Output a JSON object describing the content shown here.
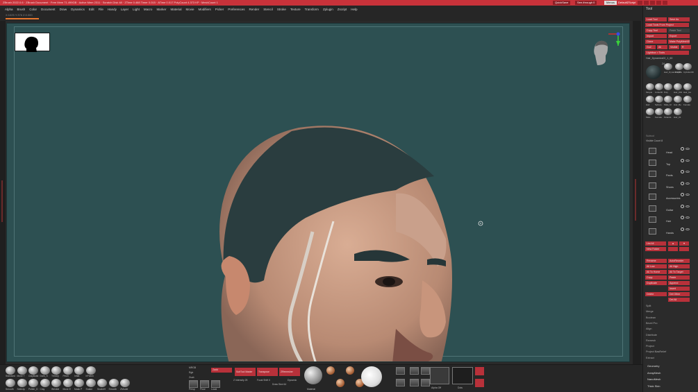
{
  "titlebar": {
    "title": "ZBrush 2022.0.6 · ZBrush Document · Free Mem 71.499GB · Active Mem 2311 · Scratch Disk 48 · ZTime 0.468 Timer 0.015 · ATime 0.017 PolyCount 4.373 KP · MeshCount 1",
    "quicksave": "QuickSave",
    "seethrough": "See-through 0",
    "menus": "Menus",
    "defaultscript": "DefaultZScript"
  },
  "menubar": [
    "Alpha",
    "Brush",
    "Color",
    "Document",
    "Draw",
    "Dynamics",
    "Edit",
    "File",
    "Handy",
    "Layer",
    "Light",
    "Macro",
    "Marker",
    "Material",
    "Movie",
    "Modifiers",
    "Picker",
    "Preferences",
    "Render",
    "Stencil",
    "Stroke",
    "Texture",
    "Transform",
    "Zplugin",
    "Zscript",
    "Help"
  ],
  "infobar": {
    "coords": "X:1025 Y:376 Z:0.000",
    "progress": 0.05
  },
  "tray": {
    "title": "Tool",
    "top_buttons": [
      [
        "Load Tool",
        "Save As"
      ],
      [
        "Load Tools From Project"
      ],
      [
        "Copy Tool",
        "Paste Tool"
      ],
      [
        "Import",
        "Export"
      ],
      [
        "Clone",
        "Make PolyMesh3D"
      ],
      [
        "GoZ",
        "All",
        "Visible",
        "R"
      ],
      [
        "Lightbox > Tools"
      ]
    ],
    "current_tool": "Hair_Dynamics02_1_60",
    "tool_count": "24",
    "tool_labels": [
      "Hair_Dynamics02",
      "PolyMe",
      "Cylinder3D",
      "Simple",
      "Cube3D",
      "Poly",
      "Hair_001",
      "Hair_Go",
      "Hair",
      "Sphere",
      "Male_M",
      "Hair_Be",
      "Female",
      "Male",
      "Female",
      "Strands",
      "Hair_01"
    ],
    "subtool_header": "Subtool",
    "visible_count": "Visible Count 8",
    "subtools": [
      "Head",
      "Top",
      "Pants",
      "Shoes",
      "Accessories",
      "Guitar",
      "Hair",
      "Hands"
    ],
    "list_buttons": [
      [
        "List All",
        "▲",
        "▼"
      ],
      [
        "New Folder",
        "",
        ""
      ]
    ],
    "action_buttons": [
      [
        "Rename",
        "AutoReorder"
      ],
      [
        "All Low",
        "All High"
      ],
      [
        "All To Home",
        "All To Target"
      ],
      [
        "Copy",
        "Paste"
      ],
      [
        "Duplicate",
        "Append"
      ],
      [
        "",
        "Insert"
      ],
      [
        "Delete",
        "Del Other"
      ],
      [
        "",
        "Del All"
      ]
    ],
    "menu_items": [
      "Split",
      "Merge",
      "Boolean",
      "Bevel Pro",
      "Align",
      "Distribute",
      "Remesh",
      "Project",
      "Project BasRelief",
      "Extract"
    ],
    "sections": [
      "Geometry",
      "ArrayMesh",
      "NanoMesh",
      "Thick Skin"
    ]
  },
  "bottom": {
    "brushes_top": [
      "Standard",
      "Move T",
      "ClayBuild",
      "Dam_S",
      "TrimDy",
      "Pinch",
      "Inflat",
      "hPolish"
    ],
    "brushes_bot": [
      "Smooth",
      "Selectp",
      "Polish_D",
      "Clay",
      "Wrinkle",
      "Move E",
      "Mask P",
      "Snake",
      "SnakeH",
      "Smooth",
      "ZModel"
    ],
    "tool_labels": [
      "Standard",
      "Selectp",
      "Clay",
      "Dam_St",
      "Move",
      "Move T",
      "TrimDy",
      "Morph",
      "SliceCur",
      "ClipCur",
      "SelectR",
      "SelectL"
    ],
    "mrgb": "MRGB",
    "rgb": "Rgb",
    "m": "M",
    "zadd": "Zadd",
    "zsub": "Zsub",
    "zintensity": "Z Intensity 25",
    "focal_shift": "Focal Shift 0",
    "draw_size": "Draw Size 64",
    "sub_tool_master": "SubTool Master",
    "transpose_master": "Transpose",
    "zremesher": "ZRemesher",
    "dynamic": "Dynamic",
    "material": "MatCap",
    "alpha_off": "Alpha Off",
    "texture_off": "Texture Off",
    "persp": "Persp",
    "floor": "Floor",
    "local": "Local",
    "material_name": "Material",
    "stroke": "Dots"
  },
  "colors": {
    "accent": "#b8313a",
    "viewport": "#2d5052",
    "hair": "#2a3d3f",
    "skin": "#c89a82"
  }
}
